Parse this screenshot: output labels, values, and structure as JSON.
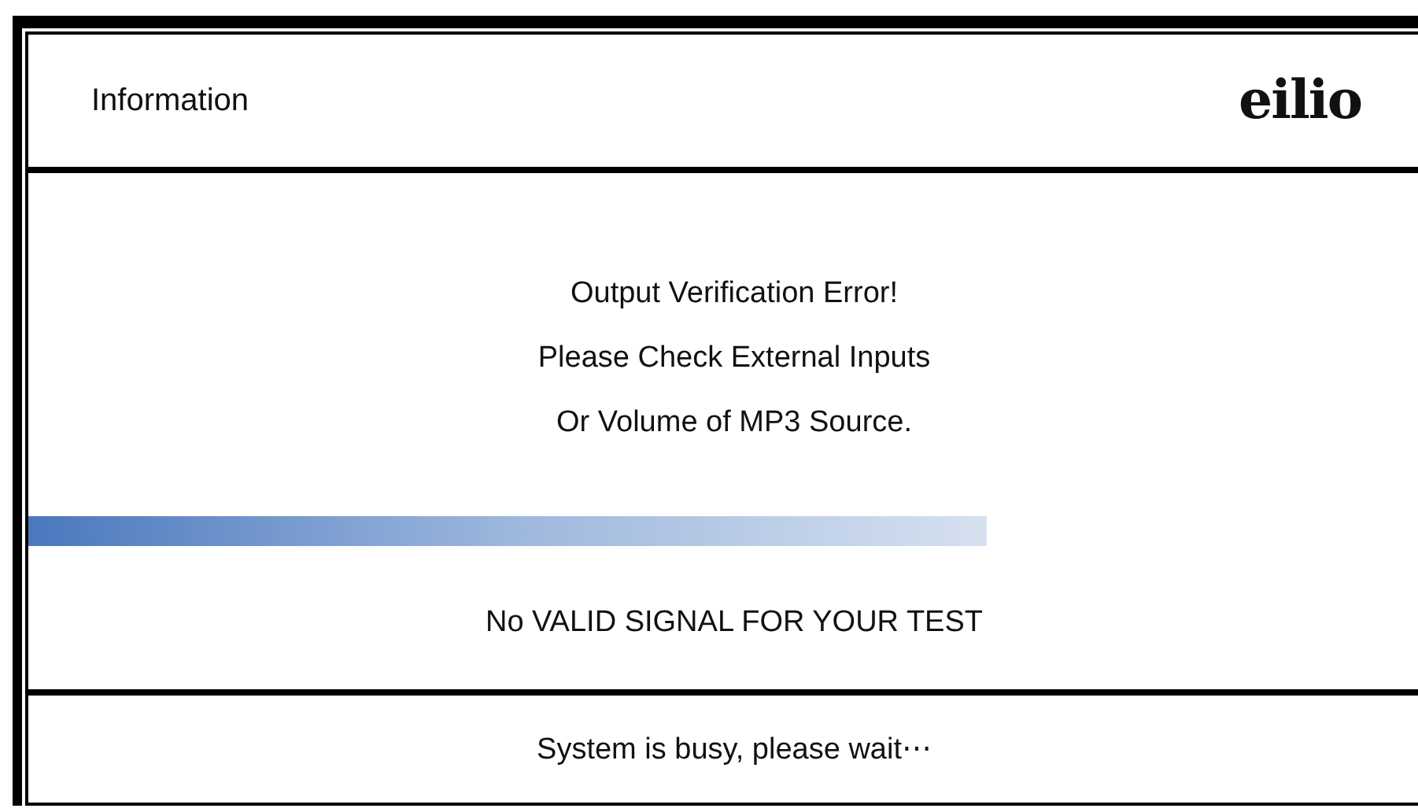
{
  "header": {
    "title": "Information",
    "logo": "eilio"
  },
  "message": [
    "Output Verification Error!",
    "Please Check External Inputs",
    "Or Volume of MP3 Source."
  ],
  "progress": {
    "level": 0.69
  },
  "signal_status": "No VALID SIGNAL FOR YOUR TEST",
  "status_bar": "System is busy, please wait⋯"
}
